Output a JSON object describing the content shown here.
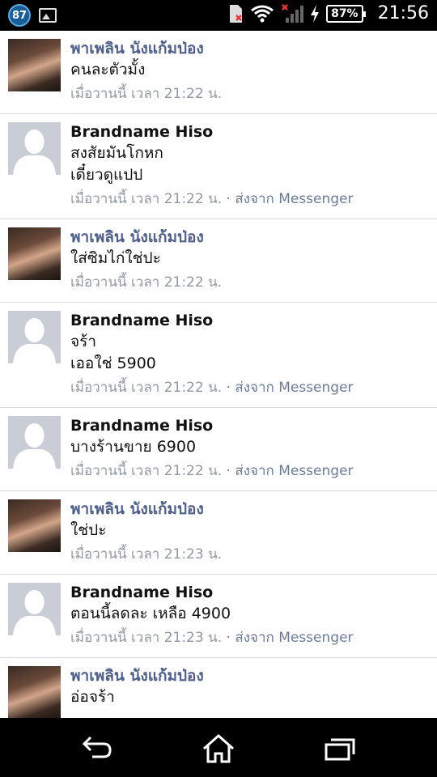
{
  "status_bar": {
    "notification_count": "87",
    "battery": "87%",
    "time": "21:56"
  },
  "messages": [
    {
      "sender": "พาเพลิน นังแก้มป่อง",
      "lines": [
        "คนละตัวมั้ง"
      ],
      "time": "เมื่อวานนี้ เวลา 21:22 น.",
      "via": ""
    },
    {
      "sender": "Brandname Hiso",
      "lines": [
        "สงสัยมันโกหก",
        "เดี๋ยวดูแปป"
      ],
      "time": "เมื่อวานนี้ เวลา 21:22 น.",
      "via": " · ส่งจาก Messenger"
    },
    {
      "sender": "พาเพลิน นังแก้มป่อง",
      "lines": [
        "ใส่ซิมไก่ใช่ปะ"
      ],
      "time": "เมื่อวานนี้ เวลา 21:22 น.",
      "via": ""
    },
    {
      "sender": "Brandname Hiso",
      "lines": [
        "จร้า",
        "เออใช่ 5900"
      ],
      "time": "เมื่อวานนี้ เวลา 21:22 น.",
      "via": " · ส่งจาก Messenger"
    },
    {
      "sender": "Brandname Hiso",
      "lines": [
        "บางร้านขาย 6900"
      ],
      "time": "เมื่อวานนี้ เวลา 21:22 น.",
      "via": " · ส่งจาก Messenger"
    },
    {
      "sender": "พาเพลิน นังแก้มป่อง",
      "lines": [
        "ใช่ปะ"
      ],
      "time": "เมื่อวานนี้ เวลา 21:23 น.",
      "via": ""
    },
    {
      "sender": "Brandname Hiso",
      "lines": [
        "ตอนนี้ลดละ เหลือ 4900"
      ],
      "time": "เมื่อวานนี้ เวลา 21:23 น.",
      "via": " · ส่งจาก Messenger"
    },
    {
      "sender": "พาเพลิน นังแก้มป่อง",
      "lines": [
        "อ่อจร้า"
      ],
      "time": "",
      "via": ""
    }
  ]
}
